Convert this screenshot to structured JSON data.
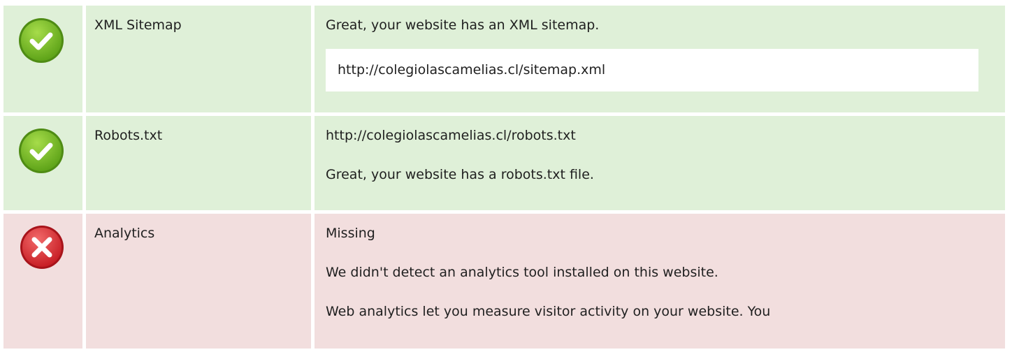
{
  "checks": [
    {
      "status": "pass",
      "icon": "check-icon",
      "name": "XML Sitemap",
      "message": "Great, your website has an XML sitemap.",
      "url": "http://colegiolascamelias.cl/sitemap.xml"
    },
    {
      "status": "pass",
      "icon": "check-icon",
      "name": "Robots.txt",
      "url": "http://colegiolascamelias.cl/robots.txt",
      "message": "Great, your website has a robots.txt file."
    },
    {
      "status": "fail",
      "icon": "cross-icon",
      "name": "Analytics",
      "result": "Missing",
      "message": "We didn't detect an analytics tool installed on this website.",
      "detail": "Web analytics let you measure visitor activity on your website. You"
    }
  ],
  "colors": {
    "pass_bg": "#dff0d8",
    "fail_bg": "#f2dede",
    "pass_icon": "#7cc12a",
    "fail_icon": "#e2323a"
  }
}
